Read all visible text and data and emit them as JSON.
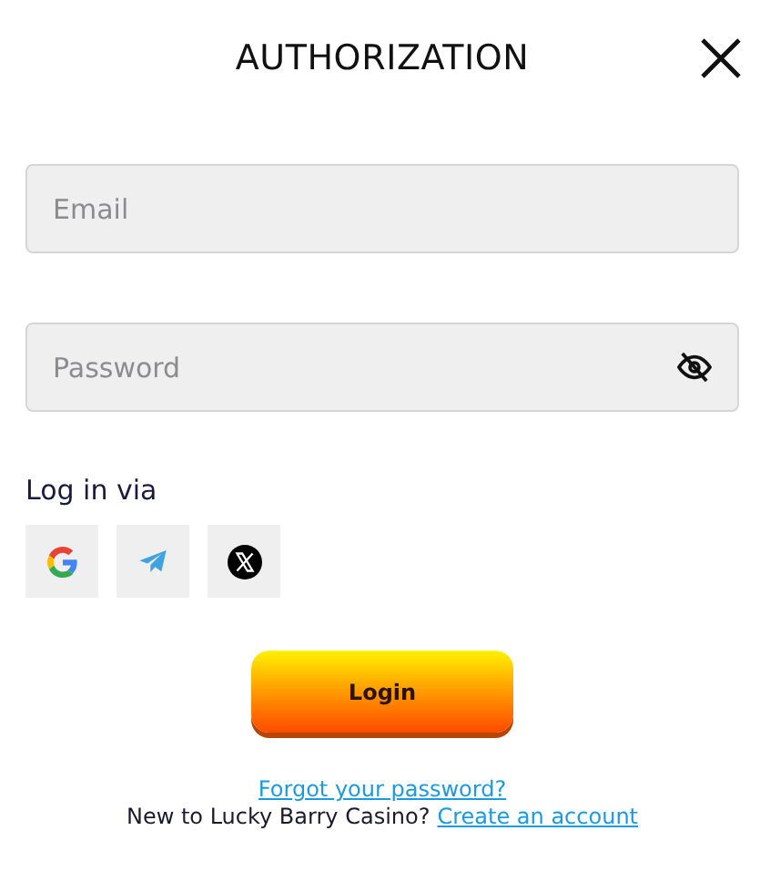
{
  "dialog": {
    "title": "AUTHORIZATION"
  },
  "fields": [
    {
      "kind": "email",
      "placeholder": "Email"
    },
    {
      "kind": "password",
      "placeholder": "Password"
    }
  ],
  "social": {
    "label": "Log in via",
    "providers": [
      {
        "kind": "google"
      },
      {
        "kind": "telegram"
      },
      {
        "kind": "x"
      }
    ]
  },
  "login_button": "Login",
  "forgot_link": "Forgot your password?",
  "signup": {
    "text": "New to Lucky Barry Casino?",
    "link": "Create an account"
  }
}
